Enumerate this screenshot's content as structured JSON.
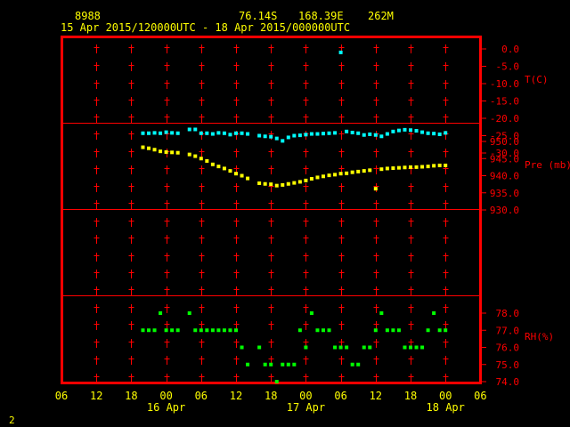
{
  "header": {
    "station": "8988",
    "lat": "76.14S",
    "lon": "168.39E",
    "elev": "262M",
    "range": "15 Apr 2015/120000UTC - 18 Apr 2015/000000UTC"
  },
  "footer": {
    "page": "2"
  },
  "colors": {
    "background": "#000000",
    "frame": "#ff0000",
    "text": "#ffff00",
    "temperature": "#00ffff",
    "pressure": "#ffff00",
    "rh": "#00ff00"
  },
  "chart_data": {
    "type": "scatter",
    "x_axis": {
      "tick_labels": [
        "06",
        "12",
        "18",
        "00",
        "06",
        "12",
        "18",
        "00",
        "06",
        "12",
        "18",
        "00",
        "06"
      ],
      "date_labels": [
        "16 Apr",
        "17 Apr",
        "18 Apr"
      ],
      "x_range_hours": [
        0,
        72
      ]
    },
    "panels": [
      {
        "name": "T(C)",
        "ylim": [
          -30,
          0
        ],
        "ticks": [
          0.0,
          -5.0,
          -10.0,
          -15.0,
          -20.0,
          -25.0,
          -30.0
        ],
        "tick_labels": [
          "0.0",
          "-5.0",
          "-10.0",
          "-15.0",
          "-20.0",
          "-25.0",
          "-30.0"
        ],
        "color": "#00ffff",
        "points": [
          [
            14,
            -24.3
          ],
          [
            15,
            -24.3
          ],
          [
            16,
            -24.2
          ],
          [
            17,
            -24.3
          ],
          [
            18,
            -24.0
          ],
          [
            19,
            -24.2
          ],
          [
            20,
            -24.3
          ],
          [
            22,
            -23.2
          ],
          [
            23,
            -23.2
          ],
          [
            24,
            -24.3
          ],
          [
            25,
            -24.3
          ],
          [
            26,
            -24.5
          ],
          [
            27,
            -24.2
          ],
          [
            28,
            -24.3
          ],
          [
            29,
            -24.7
          ],
          [
            30,
            -24.3
          ],
          [
            31,
            -24.3
          ],
          [
            32,
            -24.5
          ],
          [
            34,
            -25.0
          ],
          [
            35,
            -25.2
          ],
          [
            36,
            -25.3
          ],
          [
            37,
            -25.8
          ],
          [
            38,
            -26.5
          ],
          [
            39,
            -25.5
          ],
          [
            40,
            -25.0
          ],
          [
            41,
            -24.9
          ],
          [
            42,
            -24.7
          ],
          [
            43,
            -24.5
          ],
          [
            44,
            -24.5
          ],
          [
            45,
            -24.4
          ],
          [
            46,
            -24.3
          ],
          [
            47,
            -24.2
          ],
          [
            48,
            -1.0
          ],
          [
            49,
            -23.8
          ],
          [
            50,
            -24.1
          ],
          [
            51,
            -24.3
          ],
          [
            52,
            -24.8
          ],
          [
            53,
            -24.6
          ],
          [
            54,
            -24.8
          ],
          [
            55,
            -25.2
          ],
          [
            56,
            -24.5
          ],
          [
            57,
            -23.8
          ],
          [
            58,
            -23.5
          ],
          [
            59,
            -23.3
          ],
          [
            60,
            -23.4
          ],
          [
            61,
            -23.6
          ],
          [
            62,
            -24.0
          ],
          [
            63,
            -24.3
          ],
          [
            64,
            -24.4
          ],
          [
            65,
            -24.6
          ],
          [
            66,
            -24.2
          ]
        ]
      },
      {
        "name": "Pre (mb)",
        "ylim": [
          930,
          952
        ],
        "ticks": [
          950.0,
          945.0,
          940.0,
          935.0,
          930.0
        ],
        "tick_labels": [
          "950.0",
          "945.0",
          "940.0",
          "935.0",
          "930.0"
        ],
        "color": "#ffff00",
        "points": [
          [
            14,
            948.3
          ],
          [
            15,
            948.0
          ],
          [
            16,
            947.6
          ],
          [
            17,
            947.1
          ],
          [
            18,
            946.9
          ],
          [
            19,
            946.8
          ],
          [
            20,
            946.7
          ],
          [
            22,
            946.2
          ],
          [
            23,
            945.7
          ],
          [
            24,
            945.0
          ],
          [
            25,
            944.3
          ],
          [
            26,
            943.3
          ],
          [
            27,
            942.7
          ],
          [
            28,
            942.1
          ],
          [
            29,
            941.4
          ],
          [
            30,
            940.6
          ],
          [
            31,
            940.0
          ],
          [
            32,
            939.2
          ],
          [
            34,
            937.8
          ],
          [
            35,
            937.6
          ],
          [
            36,
            937.5
          ],
          [
            37,
            937.1
          ],
          [
            38,
            937.3
          ],
          [
            39,
            937.6
          ],
          [
            40,
            937.9
          ],
          [
            41,
            938.2
          ],
          [
            42,
            938.6
          ],
          [
            43,
            939.1
          ],
          [
            44,
            939.5
          ],
          [
            45,
            939.8
          ],
          [
            46,
            940.1
          ],
          [
            47,
            940.3
          ],
          [
            48,
            940.6
          ],
          [
            49,
            940.7
          ],
          [
            50,
            941.0
          ],
          [
            51,
            941.2
          ],
          [
            52,
            941.4
          ],
          [
            53,
            941.6
          ],
          [
            54,
            936.2
          ],
          [
            55,
            941.9
          ],
          [
            56,
            942.1
          ],
          [
            57,
            942.2
          ],
          [
            58,
            942.3
          ],
          [
            59,
            942.4
          ],
          [
            60,
            942.5
          ],
          [
            61,
            942.5
          ],
          [
            62,
            942.6
          ],
          [
            63,
            942.7
          ],
          [
            64,
            942.9
          ],
          [
            65,
            943.0
          ],
          [
            66,
            943.0
          ]
        ]
      },
      {
        "name": "RH(%)",
        "ylim": [
          74,
          79
        ],
        "ticks": [
          78.0,
          77.0,
          76.0,
          75.0,
          74.0
        ],
        "tick_labels": [
          "78.0",
          "77.0",
          "76.0",
          "75.0",
          "74.0"
        ],
        "color": "#00ff00",
        "points": [
          [
            14,
            77
          ],
          [
            15,
            77
          ],
          [
            16,
            77
          ],
          [
            17,
            78
          ],
          [
            18,
            77
          ],
          [
            19,
            77
          ],
          [
            20,
            77
          ],
          [
            22,
            78
          ],
          [
            23,
            77
          ],
          [
            24,
            77
          ],
          [
            25,
            77
          ],
          [
            26,
            77
          ],
          [
            27,
            77
          ],
          [
            28,
            77
          ],
          [
            29,
            77
          ],
          [
            30,
            77
          ],
          [
            31,
            76
          ],
          [
            32,
            75
          ],
          [
            34,
            76
          ],
          [
            35,
            75
          ],
          [
            36,
            75
          ],
          [
            37,
            74
          ],
          [
            38,
            75
          ],
          [
            39,
            75
          ],
          [
            40,
            75
          ],
          [
            41,
            77
          ],
          [
            42,
            76
          ],
          [
            43,
            78
          ],
          [
            44,
            77
          ],
          [
            45,
            77
          ],
          [
            46,
            77
          ],
          [
            47,
            76
          ],
          [
            48,
            76
          ],
          [
            49,
            76
          ],
          [
            50,
            75
          ],
          [
            51,
            75
          ],
          [
            52,
            76
          ],
          [
            53,
            76
          ],
          [
            54,
            77
          ],
          [
            55,
            78
          ],
          [
            56,
            77
          ],
          [
            57,
            77
          ],
          [
            58,
            77
          ],
          [
            59,
            76
          ],
          [
            60,
            76
          ],
          [
            61,
            76
          ],
          [
            62,
            76
          ],
          [
            63,
            77
          ],
          [
            64,
            78
          ],
          [
            65,
            77
          ],
          [
            66,
            77
          ]
        ]
      }
    ]
  }
}
